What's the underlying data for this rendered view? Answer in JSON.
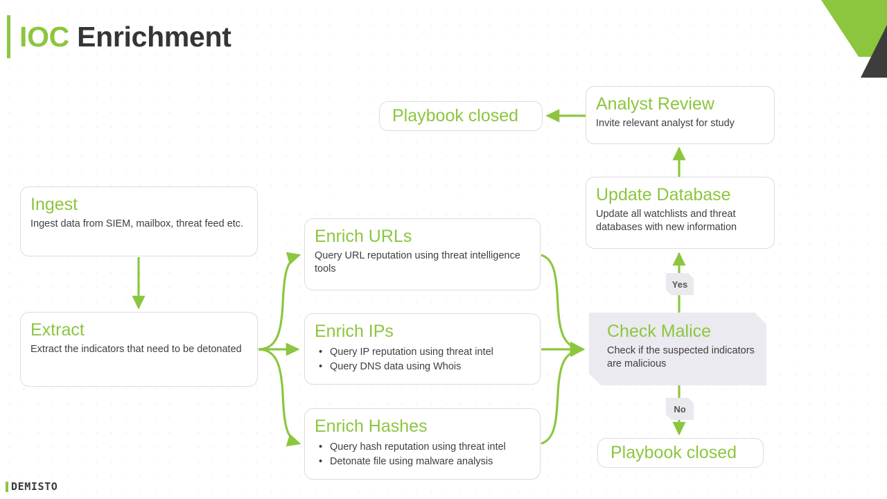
{
  "slide": {
    "title_accent": "IOC",
    "title_rest": " Enrichment",
    "footer_logo": "DEMISTO",
    "accent_color": "#8cc63f",
    "dark_color": "#3d3d3d",
    "decision_fill": "#eaeaf0"
  },
  "nodes": {
    "playbook_closed_top": {
      "title": "Playbook  closed"
    },
    "analyst_review": {
      "title": "Analyst Review",
      "body": "Invite  relevant  analyst  for  study"
    },
    "update_database": {
      "title": "Update Database",
      "body": "Update all watchlists  and threat databases with  new information"
    },
    "ingest": {
      "title": "Ingest",
      "body": "Ingest  data from SIEM,  mailbox,  threat  feed etc."
    },
    "extract": {
      "title": "Extract",
      "body": "Extract  the  indicators  that  need  to  be detonated"
    },
    "enrich_urls": {
      "title": "Enrich URLs",
      "body": "Query  URL reputation  using threat intelligence tools"
    },
    "enrich_ips": {
      "title": "Enrich IPs",
      "bullets": [
        "Query  IP reputation  using threat  intel",
        "Query  DNS data using Whois"
      ]
    },
    "enrich_hashes": {
      "title": "Enrich Hashes",
      "bullets": [
        "Query  hash reputation using threat intel",
        "Detonate file using malware analysis"
      ]
    },
    "check_malice": {
      "title": "Check Malice",
      "body": "Check if the  suspected indicators are malicious"
    },
    "playbook_closed_bottom": {
      "title": "Playbook  closed"
    }
  },
  "edge_labels": {
    "yes": "Yes",
    "no": "No"
  },
  "flow_data": {
    "type": "diagram",
    "diagram_kind": "flowchart",
    "edges": [
      {
        "from": "ingest",
        "to": "extract",
        "label": ""
      },
      {
        "from": "extract",
        "to": "enrich_urls",
        "label": ""
      },
      {
        "from": "extract",
        "to": "enrich_ips",
        "label": ""
      },
      {
        "from": "extract",
        "to": "enrich_hashes",
        "label": ""
      },
      {
        "from": "enrich_urls",
        "to": "check_malice",
        "label": ""
      },
      {
        "from": "enrich_ips",
        "to": "check_malice",
        "label": ""
      },
      {
        "from": "enrich_hashes",
        "to": "check_malice",
        "label": ""
      },
      {
        "from": "check_malice",
        "to": "update_database",
        "label": "Yes"
      },
      {
        "from": "check_malice",
        "to": "playbook_closed_bottom",
        "label": "No"
      },
      {
        "from": "update_database",
        "to": "analyst_review",
        "label": ""
      },
      {
        "from": "analyst_review",
        "to": "playbook_closed_top",
        "label": ""
      }
    ]
  }
}
